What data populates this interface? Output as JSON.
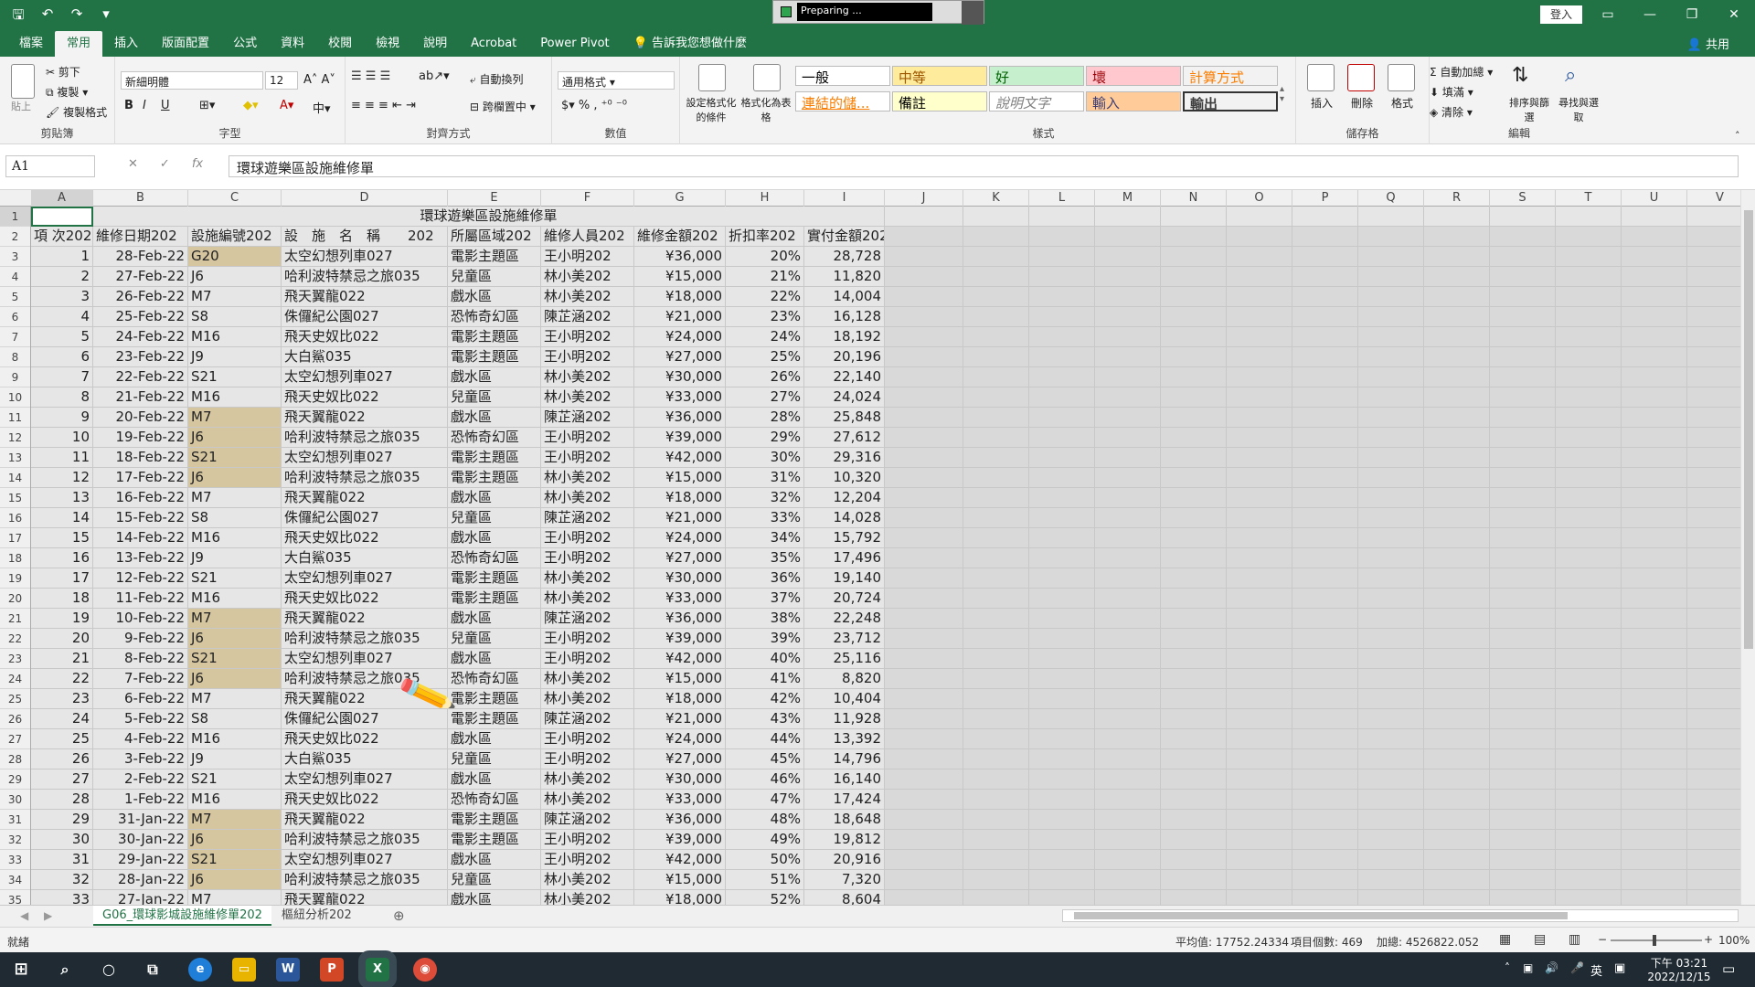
{
  "window": {
    "progress_text": "Preparing ...",
    "login": "登入",
    "share": "共用",
    "tell_me": "告訴我您想做什麼"
  },
  "tabs": [
    "檔案",
    "常用",
    "插入",
    "版面配置",
    "公式",
    "資料",
    "校閱",
    "檢視",
    "說明",
    "Acrobat",
    "Power Pivot"
  ],
  "active_tab": "常用",
  "ribbon": {
    "clipboard": {
      "label": "剪貼簿",
      "cut": "剪下",
      "copy": "複製",
      "format_painter": "複製格式",
      "paste": "貼上"
    },
    "font": {
      "label": "字型",
      "name": "新細明體",
      "size": "12"
    },
    "alignment": {
      "label": "對齊方式",
      "wrap": "自動換列",
      "merge": "跨欄置中"
    },
    "number": {
      "label": "數值",
      "format": "通用格式"
    },
    "conditional": {
      "cf": "設定格式化的條件",
      "table": "格式化為表格"
    },
    "styles": {
      "label": "樣式",
      "items": [
        {
          "name": "一般",
          "bg": "#ffffff",
          "fg": "#000000"
        },
        {
          "name": "中等",
          "bg": "#ffeb9c",
          "fg": "#9c5700"
        },
        {
          "name": "好",
          "bg": "#c6efce",
          "fg": "#006100"
        },
        {
          "name": "壞",
          "bg": "#ffc7ce",
          "fg": "#9c0006"
        },
        {
          "name": "計算方式",
          "bg": "#f2f2f2",
          "fg": "#fa7d00"
        },
        {
          "name": "連結的儲...",
          "bg": "#ffffff",
          "fg": "#fa7d00"
        },
        {
          "name": "備註",
          "bg": "#ffffcc",
          "fg": "#000000"
        },
        {
          "name": "說明文字",
          "bg": "#ffffff",
          "fg": "#7f7f7f"
        },
        {
          "name": "輸入",
          "bg": "#ffcc99",
          "fg": "#3f3f76"
        },
        {
          "name": "輸出",
          "bg": "#f2f2f2",
          "fg": "#3f3f3f"
        }
      ]
    },
    "cells": {
      "label": "儲存格",
      "insert": "插入",
      "delete": "刪除",
      "format": "格式"
    },
    "editing": {
      "label": "編輯",
      "autosum": "自動加總",
      "fill": "填滿",
      "clear": "清除",
      "sort": "排序與篩選",
      "find": "尋找與選取"
    }
  },
  "formula_bar": {
    "name_box": "A1",
    "content": "環球遊樂區設施維修單"
  },
  "columns": [
    "A",
    "B",
    "C",
    "D",
    "E",
    "F",
    "G",
    "H",
    "I",
    "J",
    "K",
    "L",
    "M",
    "N",
    "O",
    "P",
    "Q",
    "R",
    "S",
    "T",
    "U",
    "V"
  ],
  "sheet_title": "環球遊樂區設施維修單",
  "headers": [
    "項 次202",
    "維修日期202",
    "設施編號202",
    "設　施　名　稱　　202",
    "所屬區域202",
    "維修人員202",
    "維修金額202",
    "折扣率202",
    "實付金額202"
  ],
  "rows": [
    [
      "1",
      "28-Feb-22",
      "G20",
      "太空幻想列車027",
      "電影主題區",
      "王小明202",
      "¥36,000",
      "20%",
      "28,728"
    ],
    [
      "2",
      "27-Feb-22",
      "J6",
      "哈利波特禁忌之旅035",
      "兒童區",
      "林小美202",
      "¥15,000",
      "21%",
      "11,820"
    ],
    [
      "3",
      "26-Feb-22",
      "M7",
      "飛天翼龍022",
      "戲水區",
      "林小美202",
      "¥18,000",
      "22%",
      "14,004"
    ],
    [
      "4",
      "25-Feb-22",
      "S8",
      "侏儸紀公園027",
      "恐怖奇幻區",
      "陳芷涵202",
      "¥21,000",
      "23%",
      "16,128"
    ],
    [
      "5",
      "24-Feb-22",
      "M16",
      "飛天史奴比022",
      "電影主題區",
      "王小明202",
      "¥24,000",
      "24%",
      "18,192"
    ],
    [
      "6",
      "23-Feb-22",
      "J9",
      "大白鯊035",
      "電影主題區",
      "王小明202",
      "¥27,000",
      "25%",
      "20,196"
    ],
    [
      "7",
      "22-Feb-22",
      "S21",
      "太空幻想列車027",
      "戲水區",
      "林小美202",
      "¥30,000",
      "26%",
      "22,140"
    ],
    [
      "8",
      "21-Feb-22",
      "M16",
      "飛天史奴比022",
      "兒童區",
      "林小美202",
      "¥33,000",
      "27%",
      "24,024"
    ],
    [
      "9",
      "20-Feb-22",
      "M7",
      "飛天翼龍022",
      "戲水區",
      "陳芷涵202",
      "¥36,000",
      "28%",
      "25,848"
    ],
    [
      "10",
      "19-Feb-22",
      "J6",
      "哈利波特禁忌之旅035",
      "恐怖奇幻區",
      "王小明202",
      "¥39,000",
      "29%",
      "27,612"
    ],
    [
      "11",
      "18-Feb-22",
      "S21",
      "太空幻想列車027",
      "電影主題區",
      "王小明202",
      "¥42,000",
      "30%",
      "29,316"
    ],
    [
      "12",
      "17-Feb-22",
      "J6",
      "哈利波特禁忌之旅035",
      "電影主題區",
      "林小美202",
      "¥15,000",
      "31%",
      "10,320"
    ],
    [
      "13",
      "16-Feb-22",
      "M7",
      "飛天翼龍022",
      "戲水區",
      "林小美202",
      "¥18,000",
      "32%",
      "12,204"
    ],
    [
      "14",
      "15-Feb-22",
      "S8",
      "侏儸紀公園027",
      "兒童區",
      "陳芷涵202",
      "¥21,000",
      "33%",
      "14,028"
    ],
    [
      "15",
      "14-Feb-22",
      "M16",
      "飛天史奴比022",
      "戲水區",
      "王小明202",
      "¥24,000",
      "34%",
      "15,792"
    ],
    [
      "16",
      "13-Feb-22",
      "J9",
      "大白鯊035",
      "恐怖奇幻區",
      "王小明202",
      "¥27,000",
      "35%",
      "17,496"
    ],
    [
      "17",
      "12-Feb-22",
      "S21",
      "太空幻想列車027",
      "電影主題區",
      "林小美202",
      "¥30,000",
      "36%",
      "19,140"
    ],
    [
      "18",
      "11-Feb-22",
      "M16",
      "飛天史奴比022",
      "電影主題區",
      "林小美202",
      "¥33,000",
      "37%",
      "20,724"
    ],
    [
      "19",
      "10-Feb-22",
      "M7",
      "飛天翼龍022",
      "戲水區",
      "陳芷涵202",
      "¥36,000",
      "38%",
      "22,248"
    ],
    [
      "20",
      "9-Feb-22",
      "J6",
      "哈利波特禁忌之旅035",
      "兒童區",
      "王小明202",
      "¥39,000",
      "39%",
      "23,712"
    ],
    [
      "21",
      "8-Feb-22",
      "S21",
      "太空幻想列車027",
      "戲水區",
      "王小明202",
      "¥42,000",
      "40%",
      "25,116"
    ],
    [
      "22",
      "7-Feb-22",
      "J6",
      "哈利波特禁忌之旅035",
      "恐怖奇幻區",
      "林小美202",
      "¥15,000",
      "41%",
      "8,820"
    ],
    [
      "23",
      "6-Feb-22",
      "M7",
      "飛天翼龍022",
      "電影主題區",
      "林小美202",
      "¥18,000",
      "42%",
      "10,404"
    ],
    [
      "24",
      "5-Feb-22",
      "S8",
      "侏儸紀公園027",
      "電影主題區",
      "陳芷涵202",
      "¥21,000",
      "43%",
      "11,928"
    ],
    [
      "25",
      "4-Feb-22",
      "M16",
      "飛天史奴比022",
      "戲水區",
      "王小明202",
      "¥24,000",
      "44%",
      "13,392"
    ],
    [
      "26",
      "3-Feb-22",
      "J9",
      "大白鯊035",
      "兒童區",
      "王小明202",
      "¥27,000",
      "45%",
      "14,796"
    ],
    [
      "27",
      "2-Feb-22",
      "S21",
      "太空幻想列車027",
      "戲水區",
      "林小美202",
      "¥30,000",
      "46%",
      "16,140"
    ],
    [
      "28",
      "1-Feb-22",
      "M16",
      "飛天史奴比022",
      "恐怖奇幻區",
      "林小美202",
      "¥33,000",
      "47%",
      "17,424"
    ],
    [
      "29",
      "31-Jan-22",
      "M7",
      "飛天翼龍022",
      "電影主題區",
      "陳芷涵202",
      "¥36,000",
      "48%",
      "18,648"
    ],
    [
      "30",
      "30-Jan-22",
      "J6",
      "哈利波特禁忌之旅035",
      "電影主題區",
      "王小明202",
      "¥39,000",
      "49%",
      "19,812"
    ],
    [
      "31",
      "29-Jan-22",
      "S21",
      "太空幻想列車027",
      "戲水區",
      "王小明202",
      "¥42,000",
      "50%",
      "20,916"
    ],
    [
      "32",
      "28-Jan-22",
      "J6",
      "哈利波特禁忌之旅035",
      "兒童區",
      "林小美202",
      "¥15,000",
      "51%",
      "7,320"
    ],
    [
      "33",
      "27-Jan-22",
      "M7",
      "飛天翼龍022",
      "戲水區",
      "林小美202",
      "¥18,000",
      "52%",
      "8,604"
    ]
  ],
  "tan_rows": [
    0,
    8,
    9,
    10,
    11,
    18,
    19,
    20,
    21,
    28,
    29,
    30,
    31
  ],
  "sheet_tabs": [
    "G06_環球影城設施維修單202",
    "樞紐分析202"
  ],
  "status": {
    "ready": "就緒",
    "average": "平均值: 17752.24334",
    "count": "項目個數: 469",
    "sum": "加總: 4526822.052",
    "zoom": "100%"
  },
  "taskbar": {
    "time": "下午 03:21",
    "date": "2022/12/15",
    "ime": "英"
  }
}
